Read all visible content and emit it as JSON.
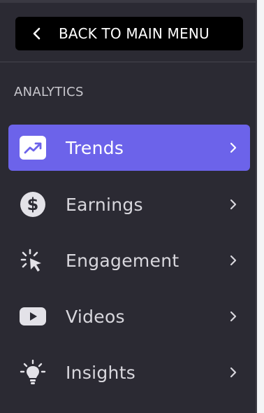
{
  "back_button": {
    "label": "BACK TO MAIN MENU",
    "icon": "chevron-left-icon"
  },
  "section": {
    "title": "ANALYTICS"
  },
  "nav": {
    "items": [
      {
        "label": "Trends",
        "icon": "trending-up-icon",
        "active": true
      },
      {
        "label": "Earnings",
        "icon": "dollar-coin-icon",
        "active": false
      },
      {
        "label": "Engagement",
        "icon": "cursor-click-icon",
        "active": false
      },
      {
        "label": "Videos",
        "icon": "play-video-icon",
        "active": false
      },
      {
        "label": "Insights",
        "icon": "lightbulb-icon",
        "active": false
      }
    ]
  },
  "colors": {
    "background": "#2b2a33",
    "active_item": "#6c63ea",
    "back_button_bg": "#000000",
    "text": "#d8d7dd"
  }
}
